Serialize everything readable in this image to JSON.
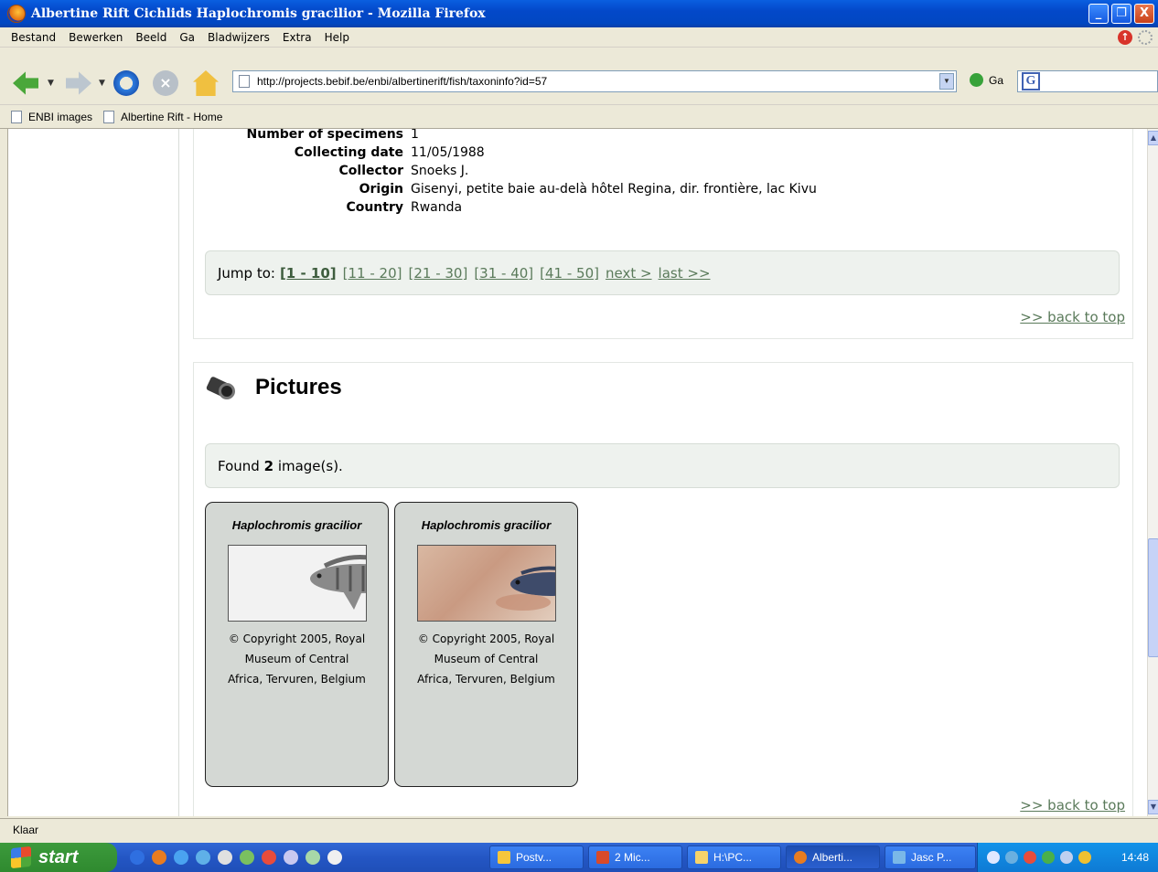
{
  "window": {
    "title": "Albertine Rift Cichlids Haplochromis gracilior - Mozilla Firefox",
    "buttons": {
      "minimize": "_",
      "maximize": "❐",
      "close": "X"
    }
  },
  "menu": [
    "Bestand",
    "Bewerken",
    "Beeld",
    "Ga",
    "Bladwijzers",
    "Extra",
    "Help"
  ],
  "navigation": {
    "url": "http://projects.bebif.be/enbi/albertinerift/fish/taxoninfo?id=57",
    "go_label": "Ga",
    "search_engine": "G"
  },
  "bookmarks": [
    "ENBI images",
    "Albertine Rift - Home"
  ],
  "specimen": {
    "fields": [
      {
        "label": "Number of specimens",
        "value": "1"
      },
      {
        "label": "Collecting date",
        "value": "11/05/1988"
      },
      {
        "label": "Collector",
        "value": "Snoeks J."
      },
      {
        "label": "Origin",
        "value": "Gisenyi, petite baie au-delà hôtel Regina, dir. frontière, lac Kivu"
      },
      {
        "label": "Country",
        "value": "Rwanda"
      }
    ]
  },
  "pagination": {
    "prefix": "Jump to:",
    "current": "[1 - 10]",
    "pages": [
      "[11 - 20]",
      "[21 - 30]",
      "[31 - 40]",
      "[41 - 50]"
    ],
    "next": "next >",
    "last": "last >>"
  },
  "back_to_top": ">> back to top",
  "pictures": {
    "heading": "Pictures",
    "found_prefix": "Found",
    "found_count": "2",
    "found_suffix": "image(s).",
    "images": [
      {
        "name": "Haplochromis gracilior",
        "copyright_l1": "© Copyright 2005, Royal",
        "copyright_l2": "Museum of Central",
        "copyright_l3": "Africa, Tervuren, Belgium"
      },
      {
        "name": "Haplochromis gracilior",
        "copyright_l1": "© Copyright 2005, Royal",
        "copyright_l2": "Museum of Central",
        "copyright_l3": "Africa, Tervuren, Belgium"
      }
    ]
  },
  "status": "Klaar",
  "taskbar": {
    "start": "start",
    "buttons": [
      "Postv...",
      "2 Mic...",
      "H:\\PC...",
      "Alberti...",
      "Jasc P..."
    ],
    "clock": "14:48"
  },
  "icons": [
    "firefox-icon",
    "back-icon",
    "forward-icon",
    "reload-icon",
    "stop-icon",
    "home-icon",
    "page-icon",
    "camera-icon",
    "windows-flag-icon"
  ]
}
